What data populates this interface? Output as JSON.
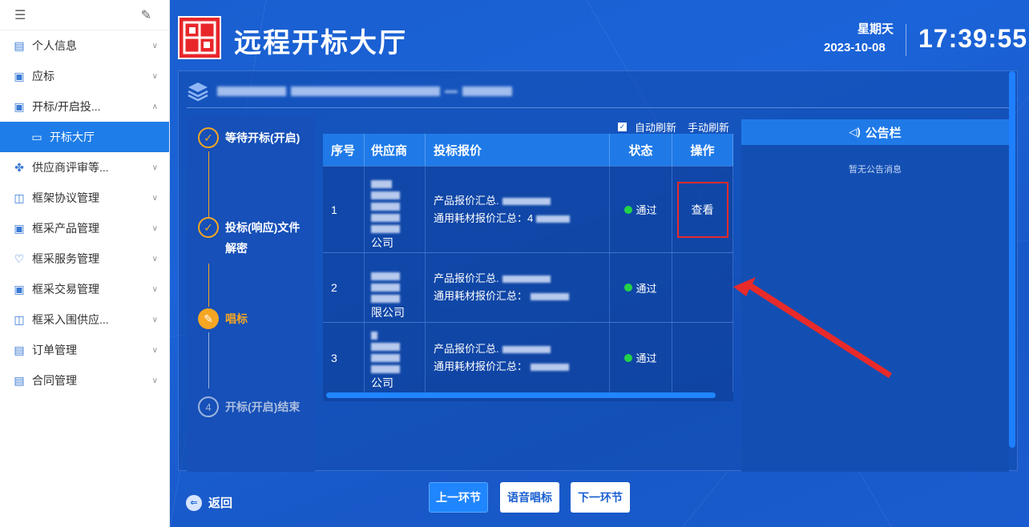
{
  "sidebar": {
    "items": [
      {
        "label": "个人信息",
        "icon": "person-icon"
      },
      {
        "label": "应标",
        "icon": "document-icon"
      },
      {
        "label": "开标/开启投...",
        "icon": "document-open-icon"
      },
      {
        "label": "开标大厅",
        "icon": "monitor-icon"
      },
      {
        "label": "供应商评审等...",
        "icon": "grid-icon"
      },
      {
        "label": "框架协议管理",
        "icon": "frame-icon"
      },
      {
        "label": "框采产品管理",
        "icon": "product-icon"
      },
      {
        "label": "框采服务管理",
        "icon": "service-icon"
      },
      {
        "label": "框采交易管理",
        "icon": "trade-icon"
      },
      {
        "label": "框采入围供应...",
        "icon": "supplier-icon"
      },
      {
        "label": "订单管理",
        "icon": "order-icon"
      },
      {
        "label": "合同管理",
        "icon": "contract-icon"
      }
    ]
  },
  "header": {
    "title": "远程开标大厅",
    "weekday": "星期天",
    "date": "2023-10-08",
    "time": "17:39:55"
  },
  "steps": [
    {
      "label": "等待开标(开启)",
      "state": "done"
    },
    {
      "label": "投标(响应)文件解密",
      "state": "done"
    },
    {
      "label": "唱标",
      "state": "current"
    },
    {
      "label": "开标(开启)结束",
      "state": "todo",
      "number": "4"
    }
  ],
  "refresh": {
    "auto": "自动刷新",
    "manual": "手动刷新"
  },
  "table": {
    "headers": [
      "序号",
      "供应商",
      "投标报价",
      "状态",
      "操作"
    ],
    "rows": [
      {
        "no": "1",
        "supplier_tail": "公司",
        "price1": "产品报价汇总.",
        "price2": "通用耗材报价汇总：4",
        "status": "通过",
        "action": "查看"
      },
      {
        "no": "2",
        "supplier_tail": "限公司",
        "price1": "产品报价汇总.",
        "price2": "通用耗材报价汇总：",
        "status": "通过",
        "action": ""
      },
      {
        "no": "3",
        "supplier_tail": "公司",
        "price1": "产品报价汇总.",
        "price2": "通用耗材报价汇总：",
        "status": "通过",
        "action": ""
      }
    ]
  },
  "notice": {
    "title": "公告栏",
    "empty": "暂无公告消息"
  },
  "footer": {
    "back": "返回",
    "prev": "上一环节",
    "voice": "语音唱标",
    "next": "下一环节"
  },
  "colors": {
    "accent": "#1f7ae8",
    "step_current": "#f5a623",
    "status_ok": "#22d348",
    "highlight": "#e82a2a"
  }
}
